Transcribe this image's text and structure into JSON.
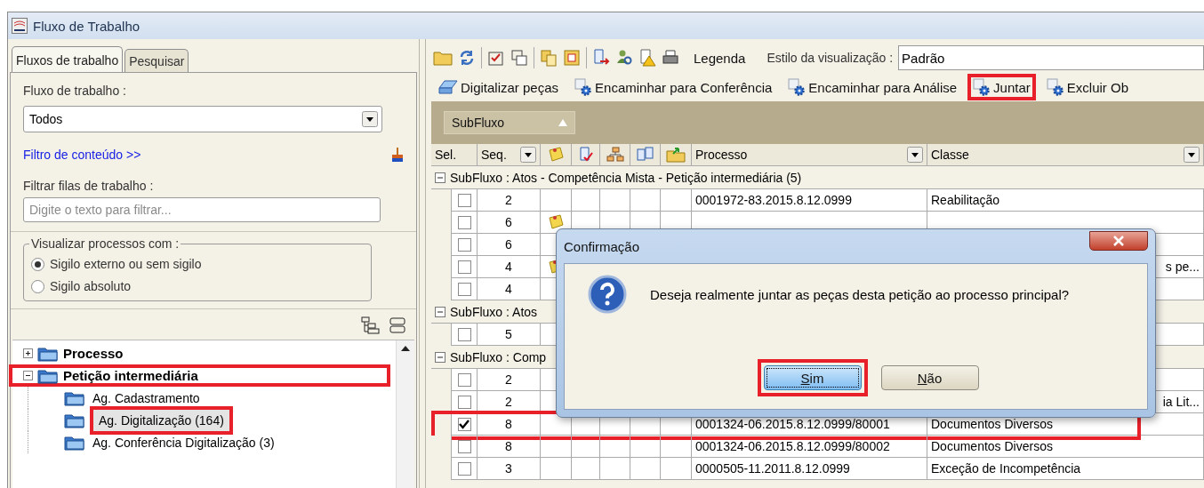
{
  "window": {
    "title": "Fluxo de Trabalho"
  },
  "left_panel": {
    "tabs": [
      {
        "label": "Fluxos de trabalho",
        "selected": true
      },
      {
        "label": "Pesquisar",
        "selected": false
      }
    ],
    "workflow_label": "Fluxo de trabalho :",
    "workflow_select": {
      "value": "Todos"
    },
    "content_filter_link": "Filtro de conteúdo >>",
    "queue_filter_label": "Filtrar filas de trabalho :",
    "queue_filter": {
      "placeholder": "Digite o texto para filtrar..."
    },
    "visibility_group": {
      "legend": "Visualizar processos com :",
      "options": [
        {
          "label": "Sigilo externo ou sem sigilo",
          "selected": true
        },
        {
          "label": "Sigilo absoluto",
          "selected": false
        }
      ]
    },
    "tree": [
      {
        "label": "Processo",
        "expanded": false,
        "highlighted": false
      },
      {
        "label": "Petição intermediária",
        "expanded": true,
        "highlighted": true,
        "children": [
          {
            "label": "Ag. Cadastramento",
            "selected": false,
            "highlighted": false
          },
          {
            "label": "Ag. Digitalização (164)",
            "selected": true,
            "highlighted": true
          },
          {
            "label": "Ag. Conferência Digitalização (3)",
            "selected": false,
            "highlighted": false
          }
        ]
      }
    ]
  },
  "toolbar": {
    "legend_button": "Legenda",
    "view_style_label": "Estilo da visualização :",
    "view_style": {
      "value": "Padrão"
    }
  },
  "actions": [
    {
      "label": "Digitalizar peças",
      "kind": "scan",
      "highlighted": false
    },
    {
      "label": "Encaminhar para Conferência",
      "kind": "gear",
      "highlighted": false
    },
    {
      "label": "Encaminhar para Análise",
      "kind": "gear",
      "highlighted": false
    },
    {
      "label": "Juntar",
      "kind": "gear",
      "highlighted": true
    },
    {
      "label": "Excluir Ob",
      "kind": "gear",
      "highlighted": false
    }
  ],
  "group_by": {
    "chip": "SubFluxo"
  },
  "table": {
    "columns": [
      {
        "label": "Sel.",
        "kind": "text"
      },
      {
        "label": "Seq.",
        "kind": "dropdown"
      },
      {
        "kind": "icon"
      },
      {
        "kind": "icon"
      },
      {
        "kind": "icon"
      },
      {
        "kind": "icon"
      },
      {
        "kind": "icon"
      },
      {
        "label": "Processo",
        "kind": "dropdown"
      },
      {
        "label": "Classe",
        "kind": "dropdown"
      }
    ],
    "groups": [
      {
        "title": "SubFluxo : Atos - Competência Mista - Petição intermediária  (5)",
        "expanded": true,
        "rows": [
          {
            "checked": false,
            "seq": "2",
            "processo": "0001972-83.2015.8.12.0999",
            "classe": "Reabilitação",
            "highlighted": false
          },
          {
            "checked": false,
            "seq": "6",
            "note": true,
            "highlighted": false
          },
          {
            "checked": false,
            "seq": "6",
            "highlighted": false
          },
          {
            "checked": false,
            "seq": "4",
            "note": true,
            "classe_tail": "s pe...",
            "highlighted": false
          },
          {
            "checked": false,
            "seq": "4",
            "highlighted": false
          }
        ]
      },
      {
        "title": "SubFluxo : Atos",
        "expanded": true,
        "rows": [
          {
            "checked": false,
            "seq": "5",
            "highlighted": false
          }
        ]
      },
      {
        "title": "SubFluxo : Comp",
        "expanded": true,
        "rows": [
          {
            "checked": false,
            "seq": "2",
            "highlighted": false
          },
          {
            "checked": false,
            "seq": "2",
            "classe_tail": "ia Lit...",
            "highlighted": false
          },
          {
            "checked": true,
            "seq": "8",
            "processo": "0001324-06.2015.8.12.0999/80001",
            "classe": "Documentos Diversos",
            "highlighted": true
          },
          {
            "checked": false,
            "seq": "8",
            "processo": "0001324-06.2015.8.12.0999/80002",
            "classe": "Documentos Diversos",
            "highlighted": false
          },
          {
            "checked": false,
            "seq": "3",
            "processo": "0000505-11.2011.8.12.0999",
            "classe": "Exceção de Incompetência",
            "highlighted": false
          }
        ]
      }
    ]
  },
  "dialog": {
    "title": "Confirmação",
    "message": "Deseja realmente juntar as peças desta petição ao processo principal?",
    "buttons": [
      {
        "label": "Sim",
        "selected": true,
        "highlighted": true
      },
      {
        "label": "Não",
        "selected": false,
        "highlighted": false
      }
    ]
  }
}
